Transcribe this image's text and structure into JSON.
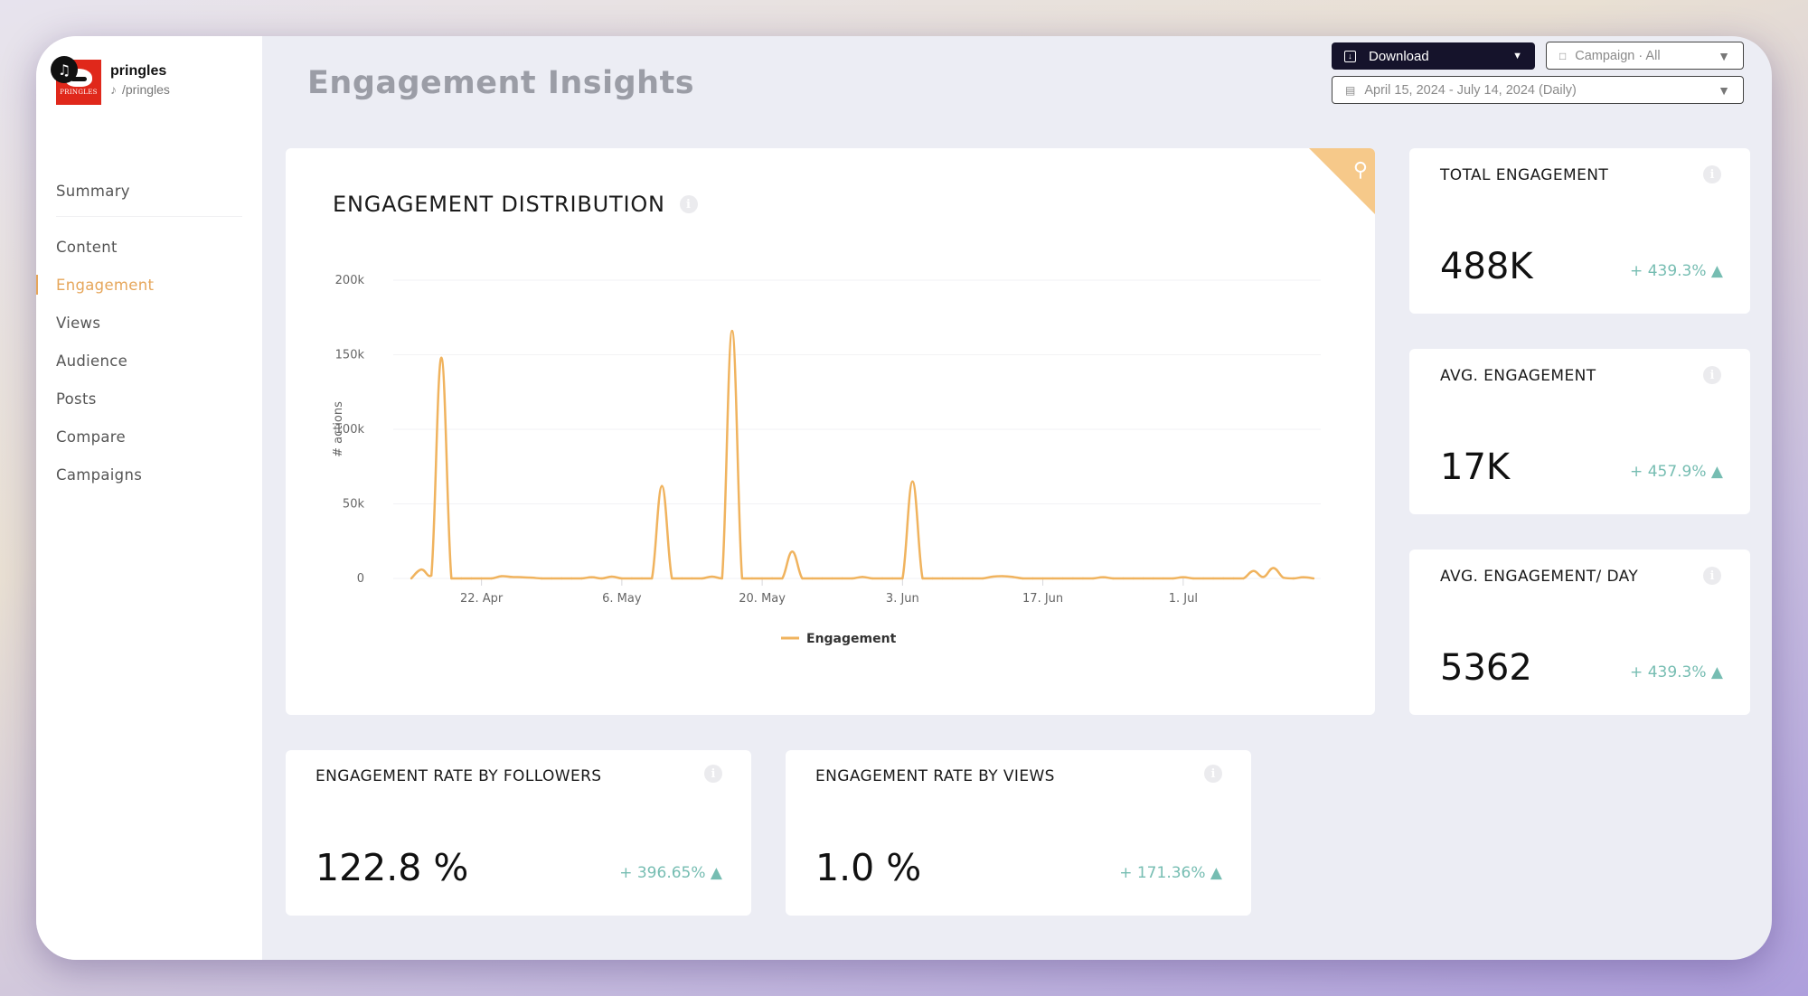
{
  "brand": {
    "name": "pringles",
    "handle": "/pringles",
    "logo_text": "PRINGLES",
    "platform_icon": "tiktok-icon"
  },
  "sidebar": {
    "items": [
      {
        "label": "Summary",
        "active": false
      },
      {
        "label": "Content",
        "active": false
      },
      {
        "label": "Engagement",
        "active": true
      },
      {
        "label": "Views",
        "active": false
      },
      {
        "label": "Audience",
        "active": false
      },
      {
        "label": "Posts",
        "active": false
      },
      {
        "label": "Compare",
        "active": false
      },
      {
        "label": "Campaigns",
        "active": false
      }
    ]
  },
  "header": {
    "title": "Engagement Insights",
    "download_label": "Download",
    "campaign_select": "Campaign · All",
    "date_range": "April 15, 2024 - July 14, 2024 (Daily)"
  },
  "colors": {
    "accent": "#e6a65a",
    "line": "#f0b35e",
    "positive": "#76bdb2",
    "download_bg": "#15132b"
  },
  "chart_card": {
    "title": "ENGAGEMENT DISTRIBUTION"
  },
  "chart_data": {
    "type": "line",
    "title": "ENGAGEMENT DISTRIBUTION",
    "xlabel": "",
    "ylabel": "# actions",
    "ylim": [
      0,
      200000
    ],
    "yticks": [
      0,
      50000,
      100000,
      150000,
      200000
    ],
    "ytick_labels": [
      "0",
      "50k",
      "100k",
      "150k",
      "200k"
    ],
    "x_start": "2024-04-15",
    "x_end": "2024-07-14",
    "xtick_labels": [
      "22. Apr",
      "6. May",
      "20. May",
      "3. Jun",
      "17. Jun",
      "1. Jul"
    ],
    "xtick_day_offsets": [
      7,
      21,
      35,
      49,
      63,
      77
    ],
    "grid": true,
    "legend": "bottom-center",
    "series": [
      {
        "name": "Engagement",
        "values": [
          0,
          6000,
          2000,
          148000,
          0,
          0,
          0,
          0,
          0,
          1500,
          1000,
          800,
          500,
          0,
          0,
          0,
          0,
          0,
          800,
          0,
          1200,
          0,
          0,
          0,
          0,
          62000,
          0,
          0,
          0,
          0,
          1200,
          0,
          166000,
          0,
          0,
          0,
          0,
          0,
          18000,
          0,
          0,
          0,
          0,
          0,
          0,
          1000,
          0,
          0,
          0,
          0,
          65000,
          0,
          0,
          0,
          0,
          0,
          0,
          0,
          1200,
          1500,
          1000,
          0,
          0,
          0,
          0,
          0,
          0,
          0,
          0,
          800,
          0,
          0,
          0,
          0,
          0,
          0,
          0,
          800,
          0,
          0,
          0,
          0,
          0,
          0,
          5000,
          1000,
          7000,
          500,
          0,
          800,
          0
        ]
      }
    ]
  },
  "kpis": [
    {
      "title": "TOTAL ENGAGEMENT",
      "value": "488K",
      "delta": "+ 439.3%"
    },
    {
      "title": "AVG. ENGAGEMENT",
      "value": "17K",
      "delta": "+ 457.9%"
    },
    {
      "title": "AVG. ENGAGEMENT/ DAY",
      "value": "5362",
      "delta": "+ 439.3%"
    }
  ],
  "rates": [
    {
      "title": "ENGAGEMENT RATE BY FOLLOWERS",
      "value": "122.8 %",
      "delta": "+ 396.65%"
    },
    {
      "title": "ENGAGEMENT RATE BY VIEWS",
      "value": "1.0 %",
      "delta": "+ 171.36%"
    }
  ]
}
